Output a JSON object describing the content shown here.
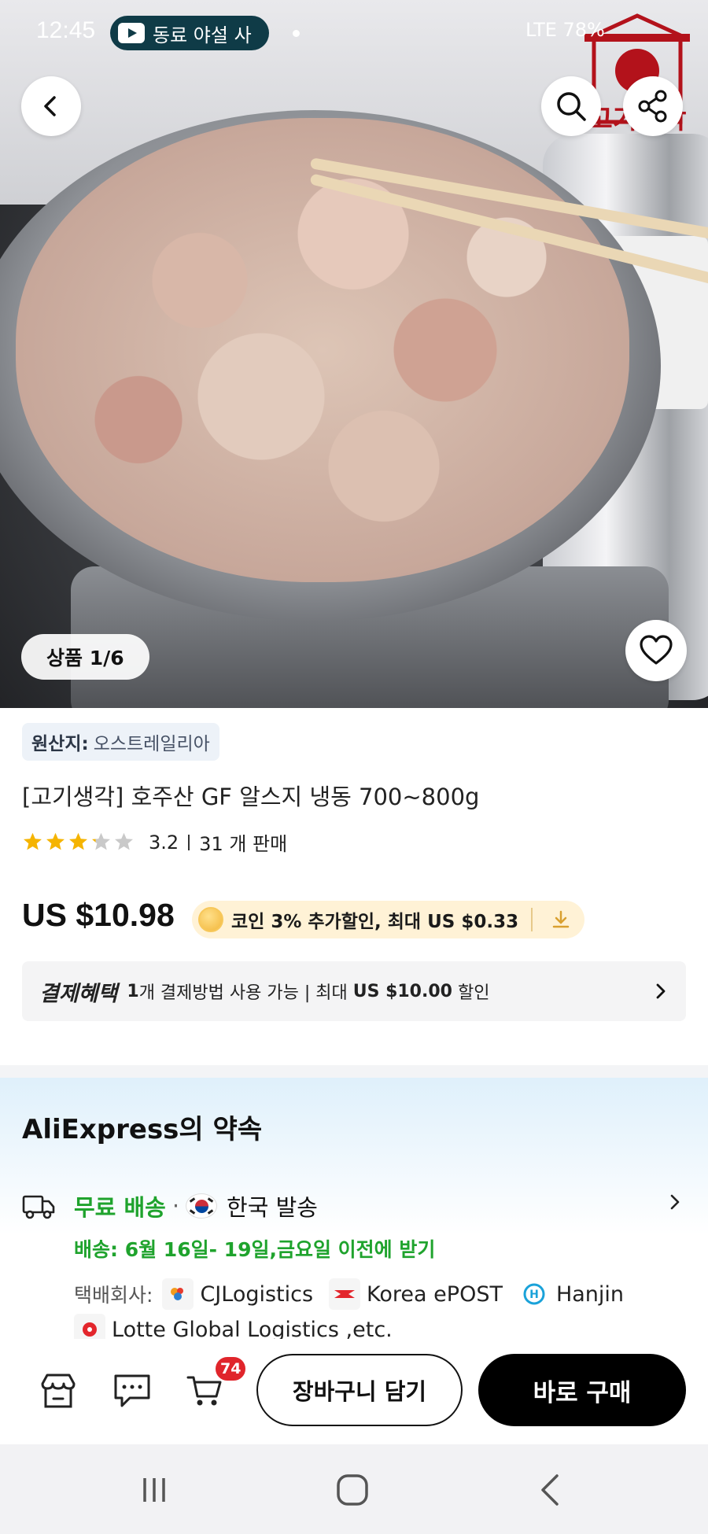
{
  "status_bar": {
    "time": "12:45",
    "notification": "동료 야설 사",
    "right_text": "LTE 78%"
  },
  "gallery": {
    "counter": "상품 1/6",
    "logo_text": "고기생각"
  },
  "product": {
    "origin_label": "원산지:",
    "origin_value": "오스트레일리아",
    "title": "[고기생각] 호주산 GF 알스지 냉동 700~800g",
    "rating": "3.2",
    "rating_stars": 3.2,
    "sold": "31 개 판매",
    "price": "US $10.98",
    "coin_promo": "코인 3% 추가할인, 최대 US $0.33"
  },
  "payment": {
    "brand": "결제혜택",
    "count": "1",
    "text1": "개 결제방법 사용 가능 | 최대 ",
    "amount": "US $10.00",
    "text2": " 할인"
  },
  "promise": {
    "title": "AliExpress의 약속",
    "free_shipping": "무료 배송",
    "dot": "·",
    "ship_from": "한국 발송",
    "delivery": "배송: 6월 16일- 19일,금요일 이전에 받기",
    "carrier_label": "택배회사:",
    "carriers": [
      "CJLogistics",
      "Korea ePOST",
      "Hanjin",
      "Lotte Global Logistics ,etc."
    ]
  },
  "action_bar": {
    "cart_count": "74",
    "add_to_cart": "장바구니 담기",
    "buy_now": "바로 구매"
  },
  "colors": {
    "accent_green": "#1fa32d",
    "badge_red": "#e0252b",
    "coin_bg": "#fff2d6"
  }
}
